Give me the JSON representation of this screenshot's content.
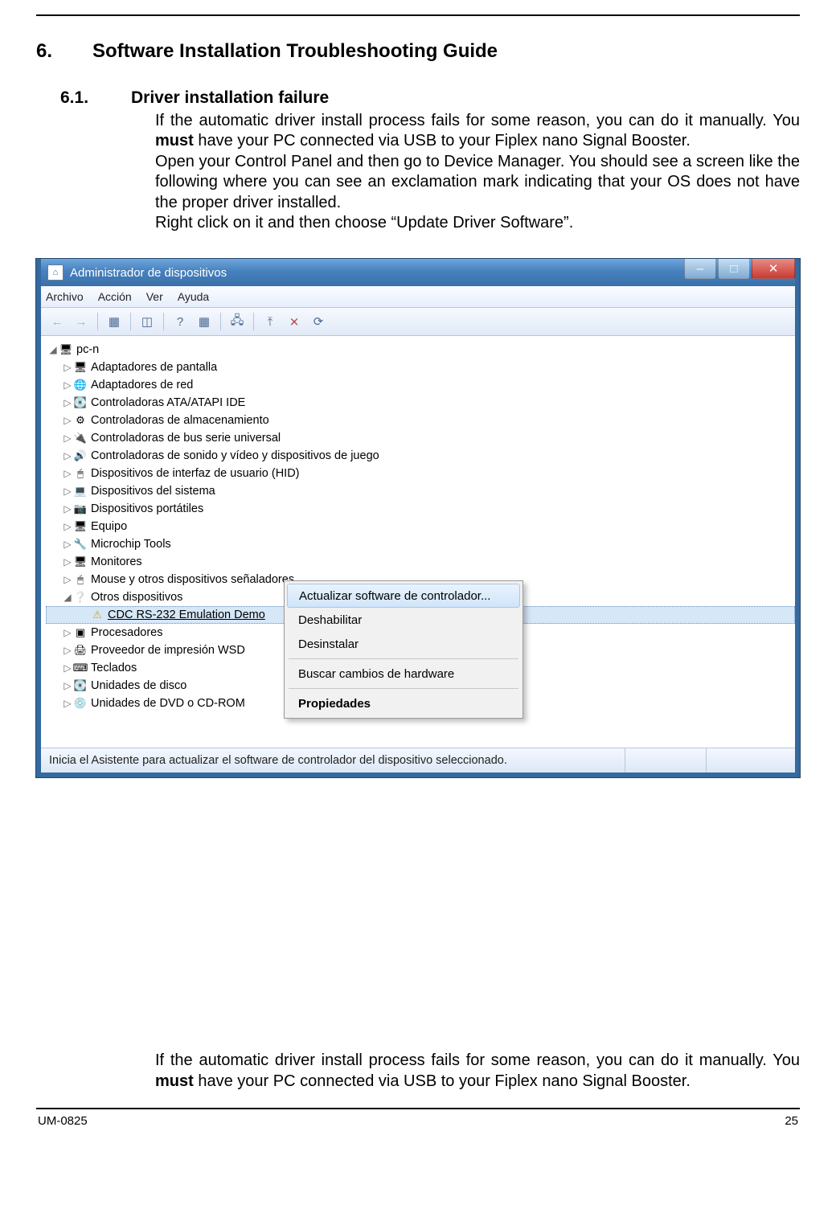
{
  "doc": {
    "h1_num": "6.",
    "h1_title": "Software Installation Troubleshooting Guide",
    "h2_num": "6.1.",
    "h2_title": "Driver installation failure",
    "p1a": "If the automatic driver install process fails for some reason, you can do it manually.  You ",
    "p1b": "must",
    "p1c": " have your PC connected via USB to your Fiplex nano Signal Booster.",
    "p2": "Open your Control Panel and then go to Device Manager. You should see a screen like the following where you can see an exclamation mark indicating that your OS does not have the proper driver installed.",
    "p3": "Right click on it and then choose “Update Driver Software”.",
    "p4a": "If the automatic driver install process fails for some reason, you can do it manually.  You ",
    "p4b": "must",
    "p4c": " have your PC connected via USB to your Fiplex nano Signal Booster.",
    "footer_left": "UM-0825",
    "footer_right": "25"
  },
  "win": {
    "title": "Administrador de dispositivos",
    "menu": {
      "m0": "Archivo",
      "m1": "Acción",
      "m2": "Ver",
      "m3": "Ayuda"
    },
    "root": "pc-n",
    "items": {
      "i0": "Adaptadores de pantalla",
      "i1": "Adaptadores de red",
      "i2": "Controladoras ATA/ATAPI IDE",
      "i3": "Controladoras de almacenamiento",
      "i4": "Controladoras de bus serie universal",
      "i5": "Controladoras de sonido y vídeo y dispositivos de juego",
      "i6": "Dispositivos de interfaz de usuario (HID)",
      "i7": "Dispositivos del sistema",
      "i8": "Dispositivos portátiles",
      "i9": "Equipo",
      "i10": "Microchip Tools",
      "i11": "Monitores",
      "i12": "Mouse y otros dispositivos señaladores",
      "i13": "Otros dispositivos",
      "i13a": "CDC RS-232 Emulation Demo",
      "i14": "Procesadores",
      "i15": "Proveedor de impresión WSD",
      "i16": "Teclados",
      "i17": "Unidades de disco",
      "i18": "Unidades de DVD o CD-ROM"
    },
    "ctx": {
      "c0": "Actualizar software de controlador...",
      "c1": "Deshabilitar",
      "c2": "Desinstalar",
      "c3": "Buscar cambios de hardware",
      "c4": "Propiedades"
    },
    "status": "Inicia el Asistente para actualizar el software de controlador del dispositivo seleccionado."
  },
  "glyph": {
    "tri_r": "▷",
    "tri_d": "◢",
    "pc": "🖥",
    "display": "🖥",
    "net": "🌐",
    "ide": "💽",
    "store": "⚙",
    "usb": "🔌",
    "sound": "🔊",
    "hid": "🖱",
    "sys": "💻",
    "port": "📷",
    "equipo": "🖥",
    "chip": "🔧",
    "mon": "🖥",
    "mouse": "🖱",
    "other": "❔",
    "warn": "⚠",
    "cpu": "▣",
    "print": "🖨",
    "kb": "⌨",
    "disk": "💽",
    "dvd": "💿",
    "min": "–",
    "max": "□",
    "close": "✕",
    "back": "←",
    "fwd": "→",
    "help": "?",
    "refresh": "⟳"
  }
}
